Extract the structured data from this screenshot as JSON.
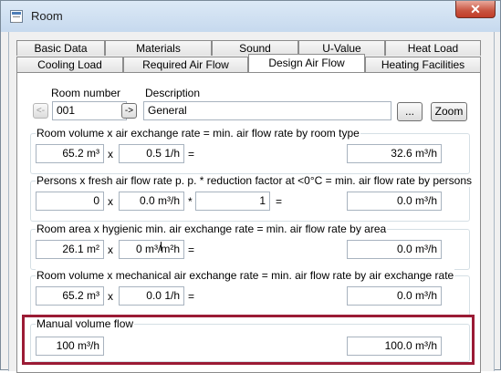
{
  "window": {
    "title": "Room",
    "close_glyph": "✕",
    "icon": "window-icon"
  },
  "tabs_row1": [
    {
      "label": "Basic Data"
    },
    {
      "label": "Materials"
    },
    {
      "label": "Sound"
    },
    {
      "label": "U-Value"
    },
    {
      "label": "Heat Load"
    }
  ],
  "tabs_row2": [
    {
      "label": "Cooling Load"
    },
    {
      "label": "Required Air Flow"
    },
    {
      "label": "Design Air Flow",
      "active": true
    },
    {
      "label": "Heating Facilities"
    }
  ],
  "header": {
    "room_number_label": "Room number",
    "description_label": "Description",
    "prev_glyph": "<-",
    "next_glyph": "->",
    "room_number": "001",
    "description": "General",
    "browse_label": "...",
    "zoom_label": "Zoom"
  },
  "groups": {
    "room_volume": {
      "legend": "Room volume x air exchange rate = min. air flow rate by room type",
      "v1": "65.2 m³",
      "op1": "x",
      "v2": "0.5 1/h",
      "eq": "=",
      "result": "32.6 m³/h"
    },
    "persons": {
      "legend": "Persons x fresh air flow rate p. p. * reduction factor at <0°C = min. air flow rate by persons",
      "v1": "0",
      "op1": "x",
      "v2": "0.0 m³/h",
      "op2": "*",
      "v3": "1",
      "eq": "=",
      "result": "0.0 m³/h"
    },
    "room_area": {
      "legend": "Room area x hygienic min. air exchange rate = min. air flow rate by area",
      "v1": "26.1 m²",
      "op1": "x",
      "v2": "0 m³/m²h",
      "eq": "=",
      "result": "0.0 m³/h"
    },
    "mechanical": {
      "legend": "Room volume x mechanical air exchange rate = min. air flow rate by air exchange rate",
      "v1": "65.2 m³",
      "op1": "x",
      "v2": "0.0 1/h",
      "eq": "=",
      "result": "0.0 m³/h"
    },
    "manual": {
      "legend": "Manual volume flow",
      "v1": "100 m³/h",
      "result": "100.0 m³/h"
    }
  },
  "colors": {
    "highlight": "#9b1b35",
    "close_button": "#c8533f"
  }
}
